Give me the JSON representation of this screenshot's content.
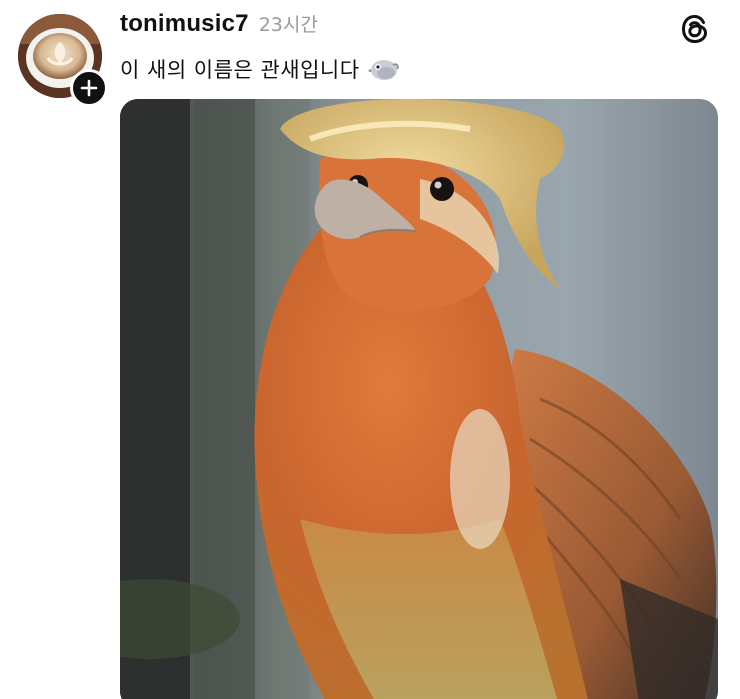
{
  "post": {
    "username": "tonimusic7",
    "timestamp": "23시간",
    "caption": "이 새의 이름은 관새입니다",
    "caption_emoji": "bird-emoji",
    "avatar_icon": "latte-art-avatar",
    "follow_icon": "plus-icon",
    "app_logo": "threads-logo-icon",
    "image_subject": "bird-photo"
  },
  "colors": {
    "text_primary": "#111111",
    "text_secondary": "#9a9a9a",
    "badge": "#111111",
    "background": "#ffffff"
  }
}
